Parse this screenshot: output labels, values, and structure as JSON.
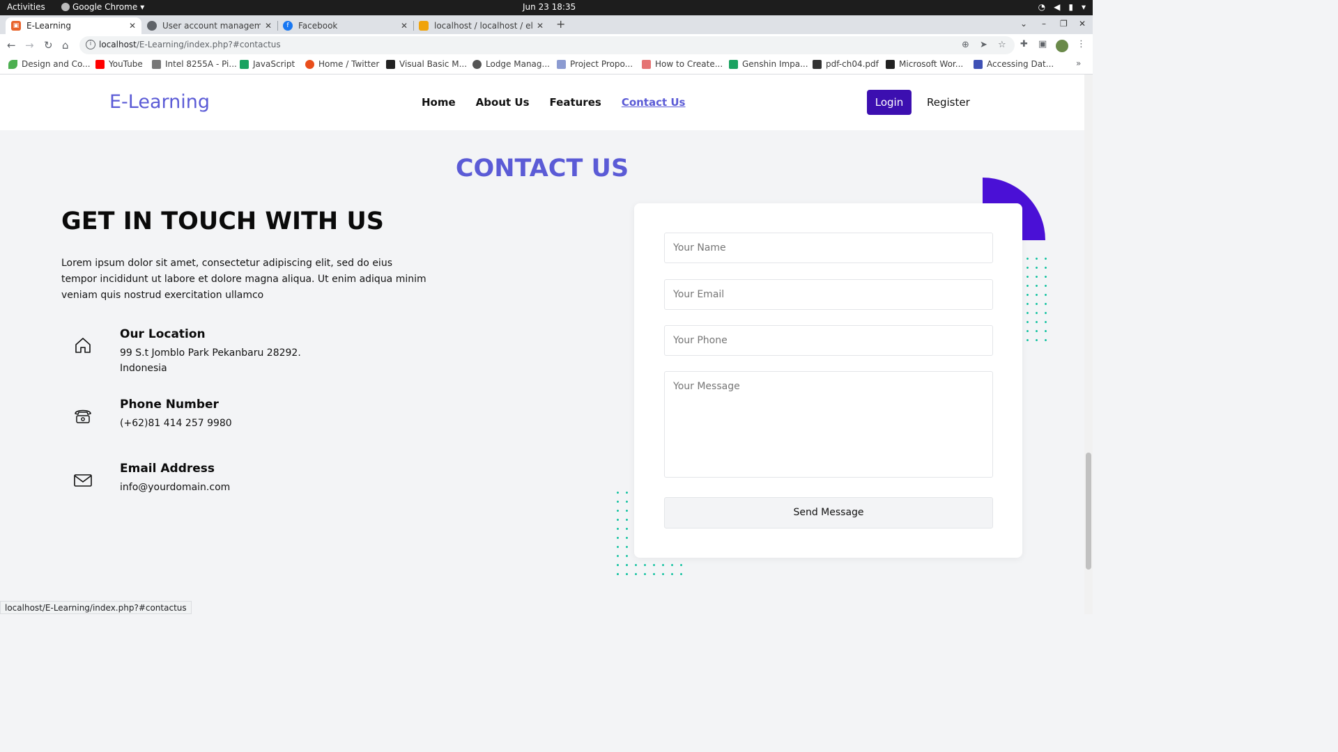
{
  "os": {
    "activities": "Activities",
    "app_name": "Google Chrome",
    "clock": "Jun 23  18:35"
  },
  "tabs": [
    {
      "title": "E-Learning",
      "favicon_color": "#e8632b"
    },
    {
      "title": "User account managemen",
      "favicon_color": "#5f6368"
    },
    {
      "title": "Facebook",
      "favicon_color": "#1877f2"
    },
    {
      "title": "localhost / localhost / ele",
      "favicon_color": "#f0a30a"
    }
  ],
  "address_bar": {
    "host": "localhost",
    "path": "/E-Learning/index.php?#contactus"
  },
  "bookmarks": [
    {
      "label": "Design and Co...",
      "color": "#4caf50"
    },
    {
      "label": "YouTube",
      "color": "#ff0000"
    },
    {
      "label": "Intel 8255A - Pi...",
      "color": "#777777"
    },
    {
      "label": "JavaScript",
      "color": "#1aa260"
    },
    {
      "label": "Home / Twitter",
      "color": "#e94e1b"
    },
    {
      "label": "Visual Basic M...",
      "color": "#222222"
    },
    {
      "label": "Lodge Manag...",
      "color": "#555555"
    },
    {
      "label": "Project Propo...",
      "color": "#8c9bd1"
    },
    {
      "label": "How to Create...",
      "color": "#e57373"
    },
    {
      "label": "Genshin Impa...",
      "color": "#1aa260"
    },
    {
      "label": "pdf-ch04.pdf",
      "color": "#333333"
    },
    {
      "label": "Microsoft Wor...",
      "color": "#222222"
    },
    {
      "label": "Accessing Dat...",
      "color": "#3f51b5"
    }
  ],
  "site": {
    "brand": "E-Learning",
    "nav": [
      "Home",
      "About Us",
      "Features",
      "Contact Us"
    ],
    "active_nav": "Contact Us",
    "login": "Login",
    "register": "Register",
    "accent_color": "#5b5bd6",
    "button_color": "#3c0fb0"
  },
  "contact": {
    "section_title": "CONTACT US",
    "heading": "GET IN TOUCH WITH US",
    "lead": "Lorem ipsum dolor sit amet, consectetur adipiscing elit, sed do eius tempor incididunt ut labore et dolore magna aliqua. Ut enim adiqua minim veniam quis nostrud exercitation ullamco",
    "items": [
      {
        "icon": "home-icon",
        "title": "Our Location",
        "value": "99 S.t Jomblo Park Pekanbaru 28292.\nIndonesia"
      },
      {
        "icon": "phone-icon",
        "title": "Phone Number",
        "value": "(+62)81 414 257 9980"
      },
      {
        "icon": "mail-icon",
        "title": "Email Address",
        "value": "info@yourdomain.com"
      }
    ]
  },
  "form": {
    "name_placeholder": "Your Name",
    "email_placeholder": "Your Email",
    "phone_placeholder": "Your Phone",
    "message_placeholder": "Your Message",
    "submit": "Send Message"
  },
  "status_bar_url": "localhost/E-Learning/index.php?#contactus"
}
